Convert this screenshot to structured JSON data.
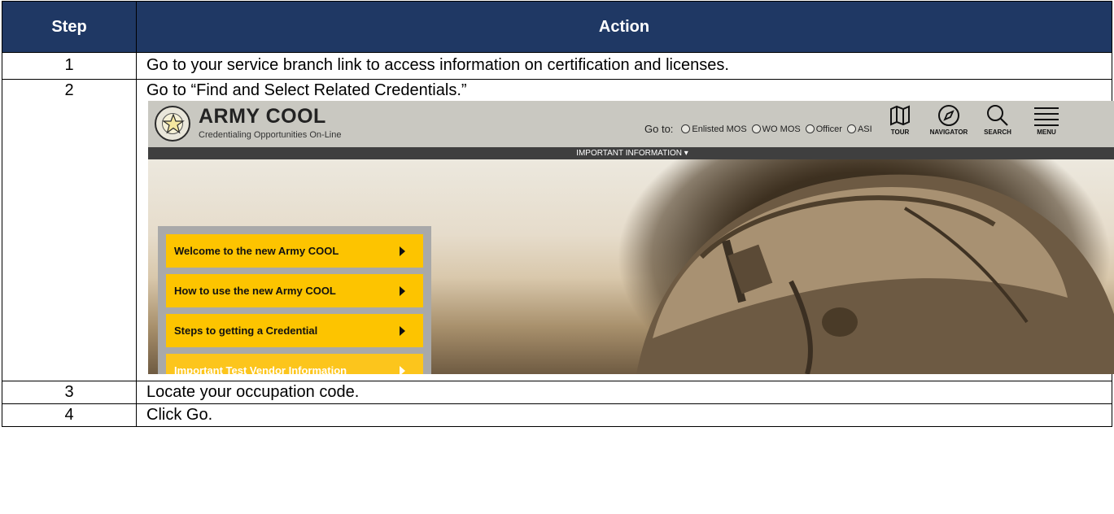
{
  "table": {
    "header_step": "Step",
    "header_action": "Action",
    "rows": [
      {
        "step": "1",
        "action": "Go to your service branch link to access information on certification and licenses."
      },
      {
        "step": "2",
        "action": "Go to “Find and Select Related Credentials.”"
      },
      {
        "step": "3",
        "action": "Locate your occupation code."
      },
      {
        "step": "4",
        "action": "Click Go."
      }
    ]
  },
  "screenshot": {
    "brand": "ARMY COOL",
    "tagline": "Credentialing Opportunities On-Line",
    "goto_label": "Go to:",
    "goto_options": [
      "Enlisted MOS",
      "WO MOS",
      "Officer",
      "ASI"
    ],
    "nav": {
      "tour": "TOUR",
      "navigator": "NAVIGATOR",
      "search": "SEARCH",
      "menu": "MENU"
    },
    "info_bar": "IMPORTANT INFORMATION",
    "info_bar_caret": "▾",
    "menu_items": [
      "Welcome to the new Army COOL",
      "How to use the new Army COOL",
      "Steps to getting a Credential",
      "Important Test Vendor Information"
    ]
  },
  "colors": {
    "table_header_bg": "#1f3864",
    "menu_item_bg": "#fdc400",
    "site_header_bg": "#c9c8c1",
    "info_bar_bg": "#3f3f3f"
  }
}
